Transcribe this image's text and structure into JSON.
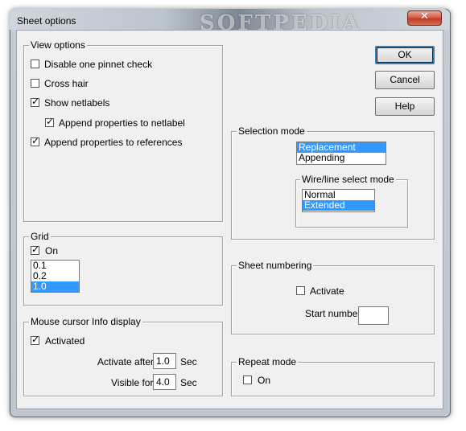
{
  "window": {
    "title": "Sheet options",
    "watermark": "SOFTPEDIA",
    "close_glyph": "✕"
  },
  "view_options": {
    "legend": "View options",
    "items": [
      {
        "label": "Disable one pinnet check",
        "checked": false
      },
      {
        "label": "Cross hair",
        "checked": false
      },
      {
        "label": "Show netlabels",
        "checked": true
      },
      {
        "label": "Append properties to netlabel",
        "checked": true
      },
      {
        "label": "Append properties to references",
        "checked": true
      }
    ]
  },
  "grid": {
    "legend": "Grid",
    "on_label": "On",
    "on_checked": true,
    "options": [
      "0.1",
      "0.2",
      "1.0"
    ],
    "selected": "1.0"
  },
  "mouse_cursor": {
    "legend": "Mouse cursor Info display",
    "activated_label": "Activated",
    "activated_checked": true,
    "activate_after_label": "Activate after",
    "activate_after_value": "1.0",
    "visible_for_label": "Visible for",
    "visible_for_value": "4.0",
    "unit": "Sec"
  },
  "buttons": {
    "ok": "OK",
    "cancel": "Cancel",
    "help": "Help"
  },
  "selection_mode": {
    "legend": "Selection mode",
    "options": [
      "Replacement",
      "Appending"
    ],
    "selected": "Replacement",
    "wire_line": {
      "legend": "Wire/line select mode",
      "options": [
        "Normal",
        "Extended"
      ],
      "selected": "Extended"
    }
  },
  "sheet_numbering": {
    "legend": "Sheet numbering",
    "activate_label": "Activate",
    "activate_checked": false,
    "start_number_label": "Start number",
    "start_number_value": ""
  },
  "repeat_mode": {
    "legend": "Repeat mode",
    "on_label": "On",
    "on_checked": false
  },
  "colors": {
    "selection": "#3399ff",
    "dialog_bg": "#f0f0f0",
    "default_button_border": "#3c7fb1"
  },
  "icons": {
    "checkmark": "check-icon",
    "close": "close-icon"
  }
}
